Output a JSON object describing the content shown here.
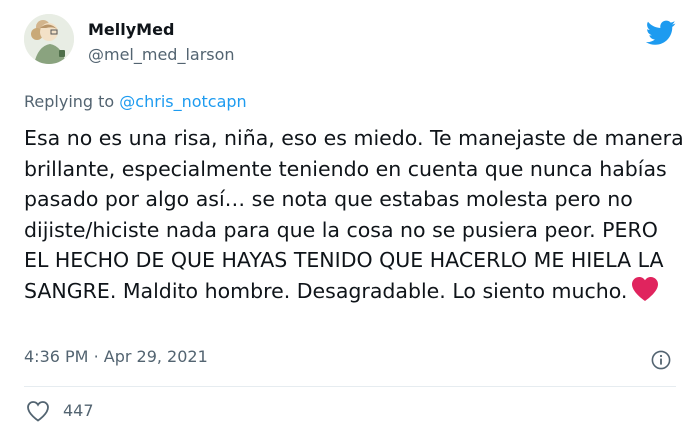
{
  "author": {
    "display_name": "MellyMed",
    "handle": "@mel_med_larson",
    "avatar_icon": "avatar-illustration"
  },
  "reply": {
    "prefix": "Replying to",
    "to_handle": "@chris_notcapn"
  },
  "tweet": {
    "text": "Esa no es una risa, niña, eso es miedo. Te manejaste de manera brillante, especialmente teniendo en cuenta que nunca habías pasado por algo así… se nota que estabas molesta pero no dijiste/hiciste nada para que la cosa no se pusiera peor. PERO EL HECHO DE QUE HAYAS TENIDO QUE HACERLO ME HIELA LA SANGRE. Maldito hombre. Desagradable. Lo siento mucho.",
    "emoji": "red-heart-icon"
  },
  "meta": {
    "time": "4:36 PM",
    "separator": "·",
    "date": "Apr 29, 2021"
  },
  "actions": {
    "like_count": "447"
  },
  "colors": {
    "twitter_blue": "#1d9bf0",
    "secondary_text": "#536471",
    "heart_red": "#e0245e"
  }
}
